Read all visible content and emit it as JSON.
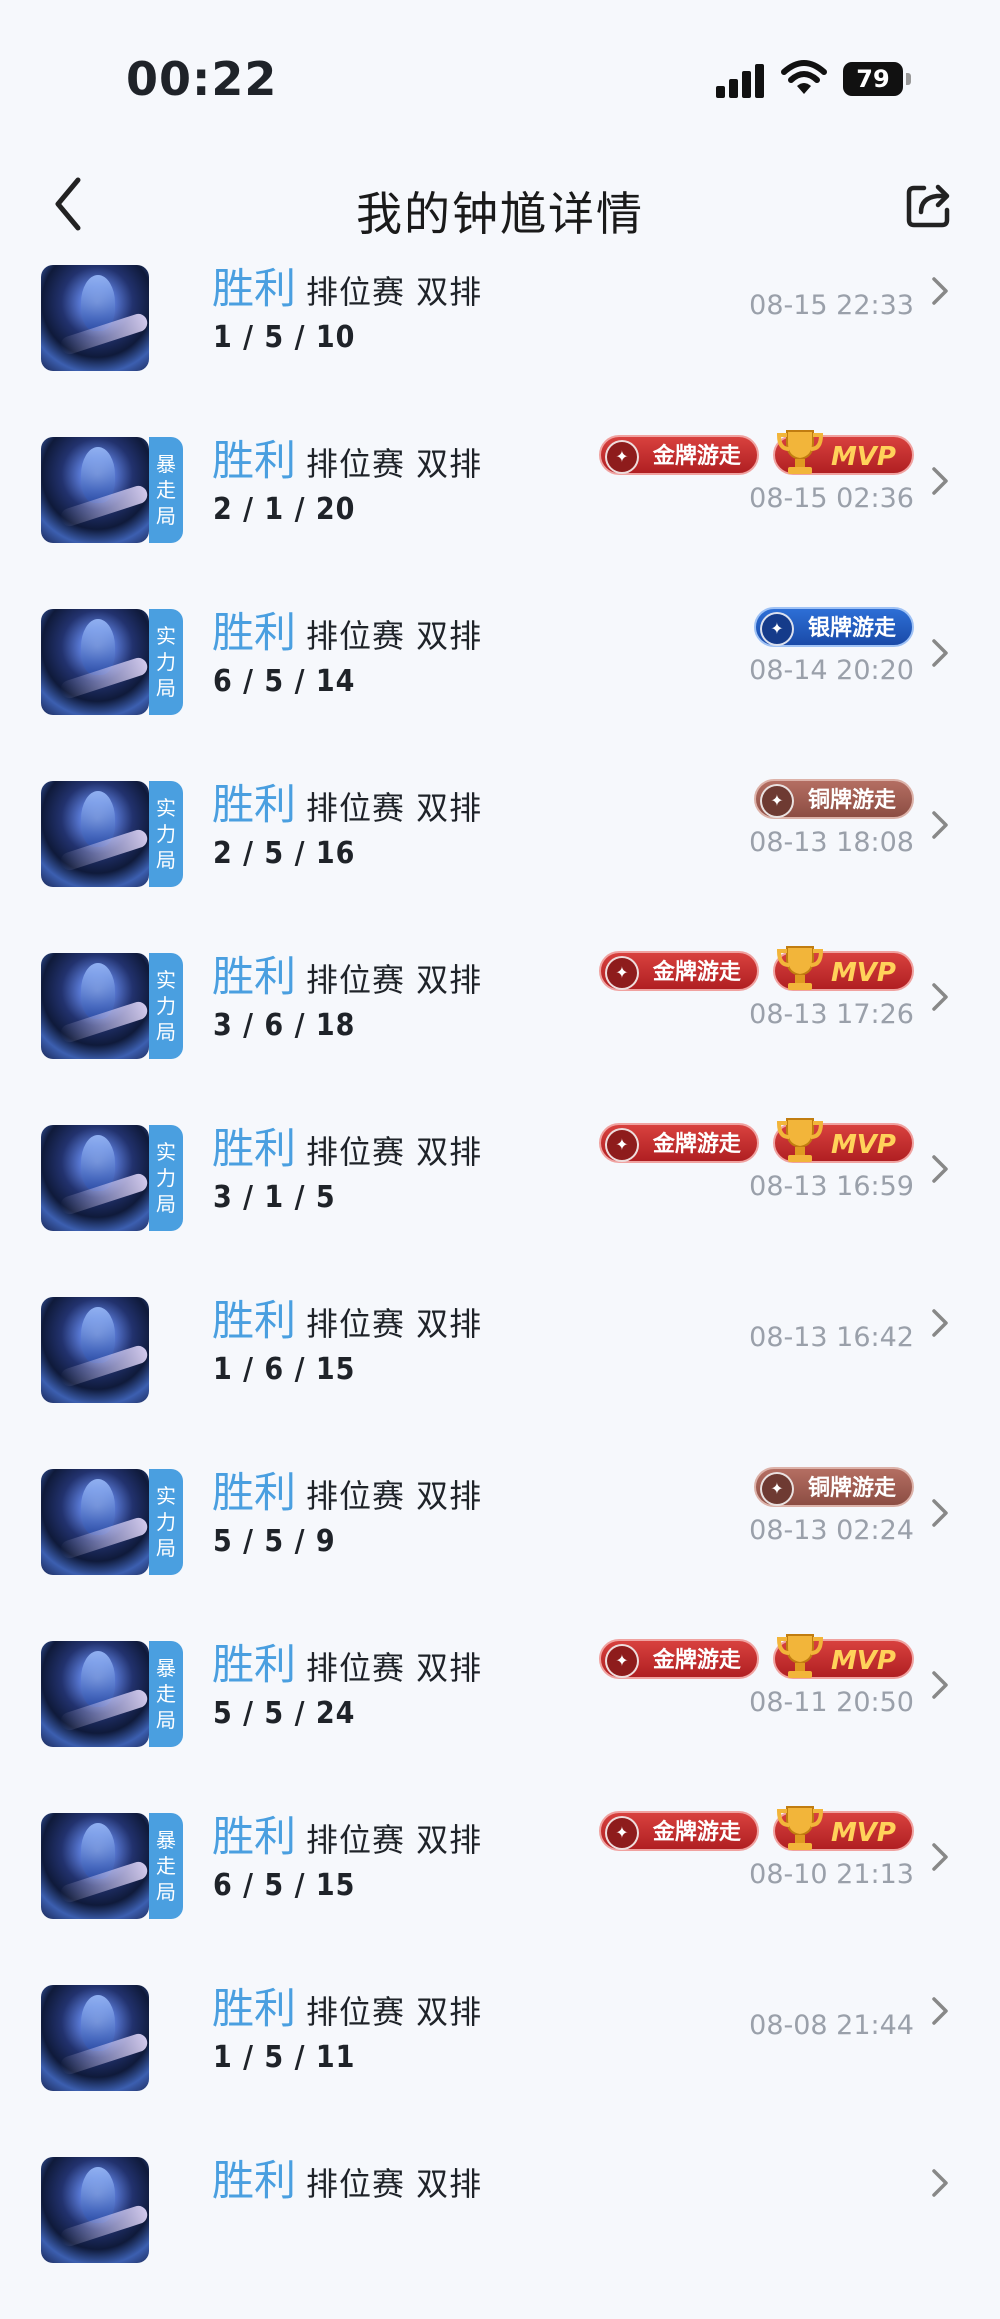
{
  "status_bar": {
    "time": "00:22",
    "battery": "79"
  },
  "nav": {
    "title": "我的钟馗详情"
  },
  "matches": [
    {
      "result": "胜利",
      "mode": "排位赛 双排",
      "kda": "1 / 5 / 10",
      "date": "08-15 22:33",
      "tag": null,
      "badges": []
    },
    {
      "result": "胜利",
      "mode": "排位赛 双排",
      "kda": "2 / 1 / 20",
      "date": "08-15 02:36",
      "tag": "暴走局",
      "badges": [
        {
          "type": "gold",
          "label": "金牌游走"
        },
        {
          "type": "mvp",
          "label": "MVP"
        }
      ]
    },
    {
      "result": "胜利",
      "mode": "排位赛 双排",
      "kda": "6 / 5 / 14",
      "date": "08-14 20:20",
      "tag": "实力局",
      "badges": [
        {
          "type": "silver",
          "label": "银牌游走"
        }
      ]
    },
    {
      "result": "胜利",
      "mode": "排位赛 双排",
      "kda": "2 / 5 / 16",
      "date": "08-13 18:08",
      "tag": "实力局",
      "badges": [
        {
          "type": "bronze",
          "label": "铜牌游走"
        }
      ]
    },
    {
      "result": "胜利",
      "mode": "排位赛 双排",
      "kda": "3 / 6 / 18",
      "date": "08-13 17:26",
      "tag": "实力局",
      "badges": [
        {
          "type": "gold",
          "label": "金牌游走"
        },
        {
          "type": "mvp",
          "label": "MVP"
        }
      ]
    },
    {
      "result": "胜利",
      "mode": "排位赛 双排",
      "kda": "3 / 1 / 5",
      "date": "08-13 16:59",
      "tag": "实力局",
      "badges": [
        {
          "type": "gold",
          "label": "金牌游走"
        },
        {
          "type": "mvp",
          "label": "MVP"
        }
      ]
    },
    {
      "result": "胜利",
      "mode": "排位赛 双排",
      "kda": "1 / 6 / 15",
      "date": "08-13 16:42",
      "tag": null,
      "badges": []
    },
    {
      "result": "胜利",
      "mode": "排位赛 双排",
      "kda": "5 / 5 / 9",
      "date": "08-13 02:24",
      "tag": "实力局",
      "badges": [
        {
          "type": "bronze",
          "label": "铜牌游走"
        }
      ]
    },
    {
      "result": "胜利",
      "mode": "排位赛 双排",
      "kda": "5 / 5 / 24",
      "date": "08-11 20:50",
      "tag": "暴走局",
      "badges": [
        {
          "type": "gold",
          "label": "金牌游走"
        },
        {
          "type": "mvp",
          "label": "MVP"
        }
      ]
    },
    {
      "result": "胜利",
      "mode": "排位赛 双排",
      "kda": "6 / 5 / 15",
      "date": "08-10 21:13",
      "tag": "暴走局",
      "badges": [
        {
          "type": "gold",
          "label": "金牌游走"
        },
        {
          "type": "mvp",
          "label": "MVP"
        }
      ]
    },
    {
      "result": "胜利",
      "mode": "排位赛 双排",
      "kda": "1 / 5 / 11",
      "date": "08-08 21:44",
      "tag": null,
      "badges": []
    },
    {
      "result": "胜利",
      "mode": "排位赛 双排",
      "kda": "",
      "date": "",
      "tag": null,
      "badges": []
    }
  ],
  "colors": {
    "accent": "#4a9fe0",
    "background": "#f6f8fc",
    "date_text": "#9aa0aa"
  },
  "icons": {
    "back": "chevron-left-icon",
    "share": "share-icon",
    "row_arrow": "chevron-right-icon"
  }
}
